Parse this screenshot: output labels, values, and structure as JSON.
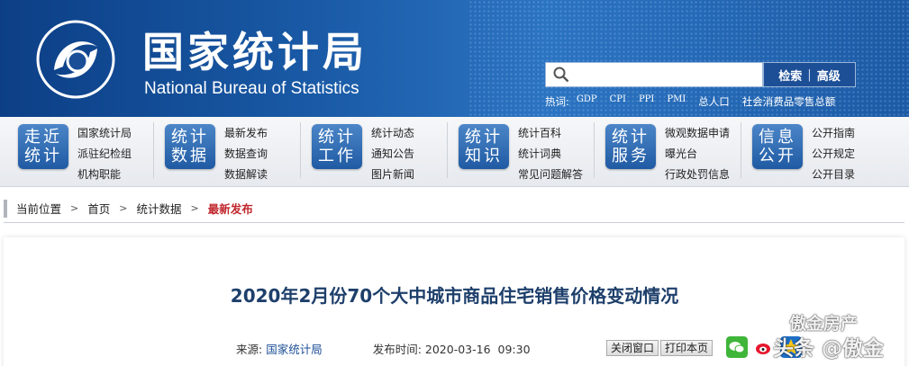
{
  "header": {
    "title_cn": "国家统计局",
    "title_en": "National Bureau of Statistics",
    "search": {
      "placeholder": "",
      "search_label": "检索",
      "advanced_label": "高级"
    },
    "hotwords_label": "热词:",
    "hotwords": [
      "GDP",
      "CPI",
      "PPI",
      "PMI",
      "总人口",
      "社会消费品零售总额"
    ]
  },
  "nav": [
    {
      "badge": [
        "走近",
        "统计"
      ],
      "links": [
        "国家统计局",
        "派驻纪检组",
        "机构职能"
      ]
    },
    {
      "badge": [
        "统计",
        "数据"
      ],
      "links": [
        "最新发布",
        "数据查询",
        "数据解读"
      ]
    },
    {
      "badge": [
        "统计",
        "工作"
      ],
      "links": [
        "统计动态",
        "通知公告",
        "图片新闻"
      ]
    },
    {
      "badge": [
        "统计",
        "知识"
      ],
      "links": [
        "统计百科",
        "统计词典",
        "常见问题解答"
      ]
    },
    {
      "badge": [
        "统计",
        "服务"
      ],
      "links": [
        "微观数据申请",
        "曝光台",
        "行政处罚信息"
      ]
    },
    {
      "badge": [
        "信息",
        "公开"
      ],
      "links": [
        "公开指南",
        "公开规定",
        "公开目录"
      ]
    }
  ],
  "breadcrumb": {
    "label": "当前位置",
    "items": [
      "首页",
      "统计数据"
    ],
    "current": "最新发布"
  },
  "article": {
    "title": "2020年2月份70个大中城市商品住宅销售价格变动情况",
    "source_label": "来源:",
    "source": "国家统计局",
    "time_label": "发布时间:",
    "time": "2020-03-16  09:30",
    "close_label": "关闭窗口",
    "print_label": "打印本页"
  },
  "watermark": {
    "line1": "傲金房产",
    "line2": "头条 @傲金"
  }
}
